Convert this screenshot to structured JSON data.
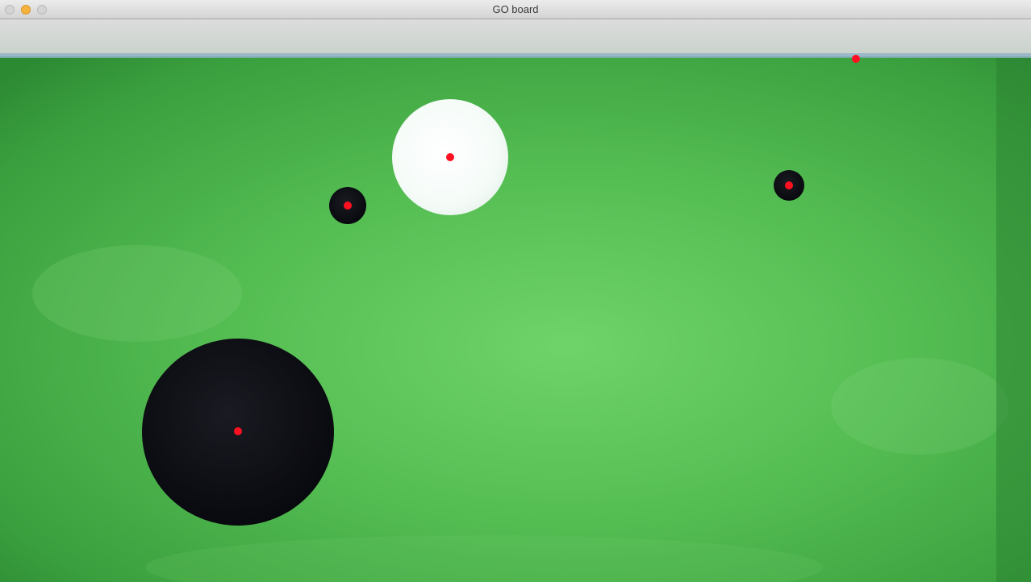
{
  "window": {
    "title": "GO board"
  },
  "controls": {
    "close": "close-button",
    "minimize": "minimize-button",
    "zoom": "zoom-button"
  },
  "board": {
    "background_color": "#4cb54f",
    "stones": [
      {
        "name": "white-stone",
        "color": "white"
      },
      {
        "name": "black-stone-small-left",
        "color": "black"
      },
      {
        "name": "black-stone-small-right",
        "color": "black"
      },
      {
        "name": "black-stone-large",
        "color": "black"
      }
    ],
    "marker_color": "#ff1020"
  }
}
